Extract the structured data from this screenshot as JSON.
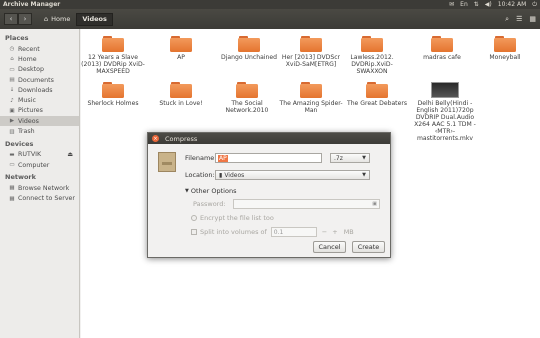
{
  "window": {
    "title": "Archive Manager"
  },
  "tray": {
    "keyboard": "En",
    "time": "10:42 AM"
  },
  "toolbar": {
    "back": "‹",
    "forward": "›",
    "breadcrumbs": [
      {
        "label": "Home"
      },
      {
        "label": "Videos"
      }
    ]
  },
  "sidebar": {
    "sections": [
      {
        "header": "Places",
        "items": [
          {
            "label": "Recent",
            "icon": "clock-icon"
          },
          {
            "label": "Home",
            "icon": "home-icon"
          },
          {
            "label": "Desktop",
            "icon": "desktop-icon"
          },
          {
            "label": "Documents",
            "icon": "document-icon"
          },
          {
            "label": "Downloads",
            "icon": "download-icon"
          },
          {
            "label": "Music",
            "icon": "music-icon"
          },
          {
            "label": "Pictures",
            "icon": "picture-icon"
          },
          {
            "label": "Videos",
            "icon": "video-icon",
            "active": true
          },
          {
            "label": "Trash",
            "icon": "trash-icon"
          }
        ]
      },
      {
        "header": "Devices",
        "items": [
          {
            "label": "RUTVIK",
            "icon": "drive-icon",
            "eject": true
          },
          {
            "label": "Computer",
            "icon": "computer-icon"
          }
        ]
      },
      {
        "header": "Network",
        "items": [
          {
            "label": "Browse Network",
            "icon": "network-icon"
          },
          {
            "label": "Connect to Server",
            "icon": "server-icon"
          }
        ]
      }
    ]
  },
  "files": [
    {
      "name": "12 Years a Slave (2013) DVDRip XviD-MAXSPEED",
      "type": "folder"
    },
    {
      "name": "AP",
      "type": "folder"
    },
    {
      "name": "Django Unchained",
      "type": "folder"
    },
    {
      "name": "Her [2013] DVDScr XviD-SaM[ETRG]",
      "type": "folder"
    },
    {
      "name": "Lawless.2012. DVDRip.XviD-SWAXXON",
      "type": "folder"
    },
    {
      "name": "madras cafe",
      "type": "folder"
    },
    {
      "name": "Moneyball",
      "type": "folder"
    },
    {
      "name": "Sherlock Holmes",
      "type": "folder"
    },
    {
      "name": "Stuck in Love!",
      "type": "folder"
    },
    {
      "name": "The Social Network.2010",
      "type": "folder"
    },
    {
      "name": "The Amazing Spider-Man",
      "type": "folder"
    },
    {
      "name": "The Great Debaters",
      "type": "folder"
    },
    {
      "name": "Delhi Belly(Hindi - English 2011)720p DVDRIP Dual.Audio X264 AAC 5.1 TDM - ‹MTR›-mastitorrents.mkv",
      "type": "video"
    }
  ],
  "dialog": {
    "title": "Compress",
    "filename_label": "Filename:",
    "filename_value": "AP",
    "extension": ".7z",
    "location_label": "Location:",
    "location_value": "Videos",
    "other_options": "Other Options",
    "password_label": "Password:",
    "password_value": "",
    "encrypt_label": "Encrypt the file list too",
    "split_label": "Split into volumes of",
    "split_value": "0.1",
    "split_minus": "−",
    "split_plus": "+",
    "split_unit": "MB",
    "cancel": "Cancel",
    "create": "Create"
  }
}
